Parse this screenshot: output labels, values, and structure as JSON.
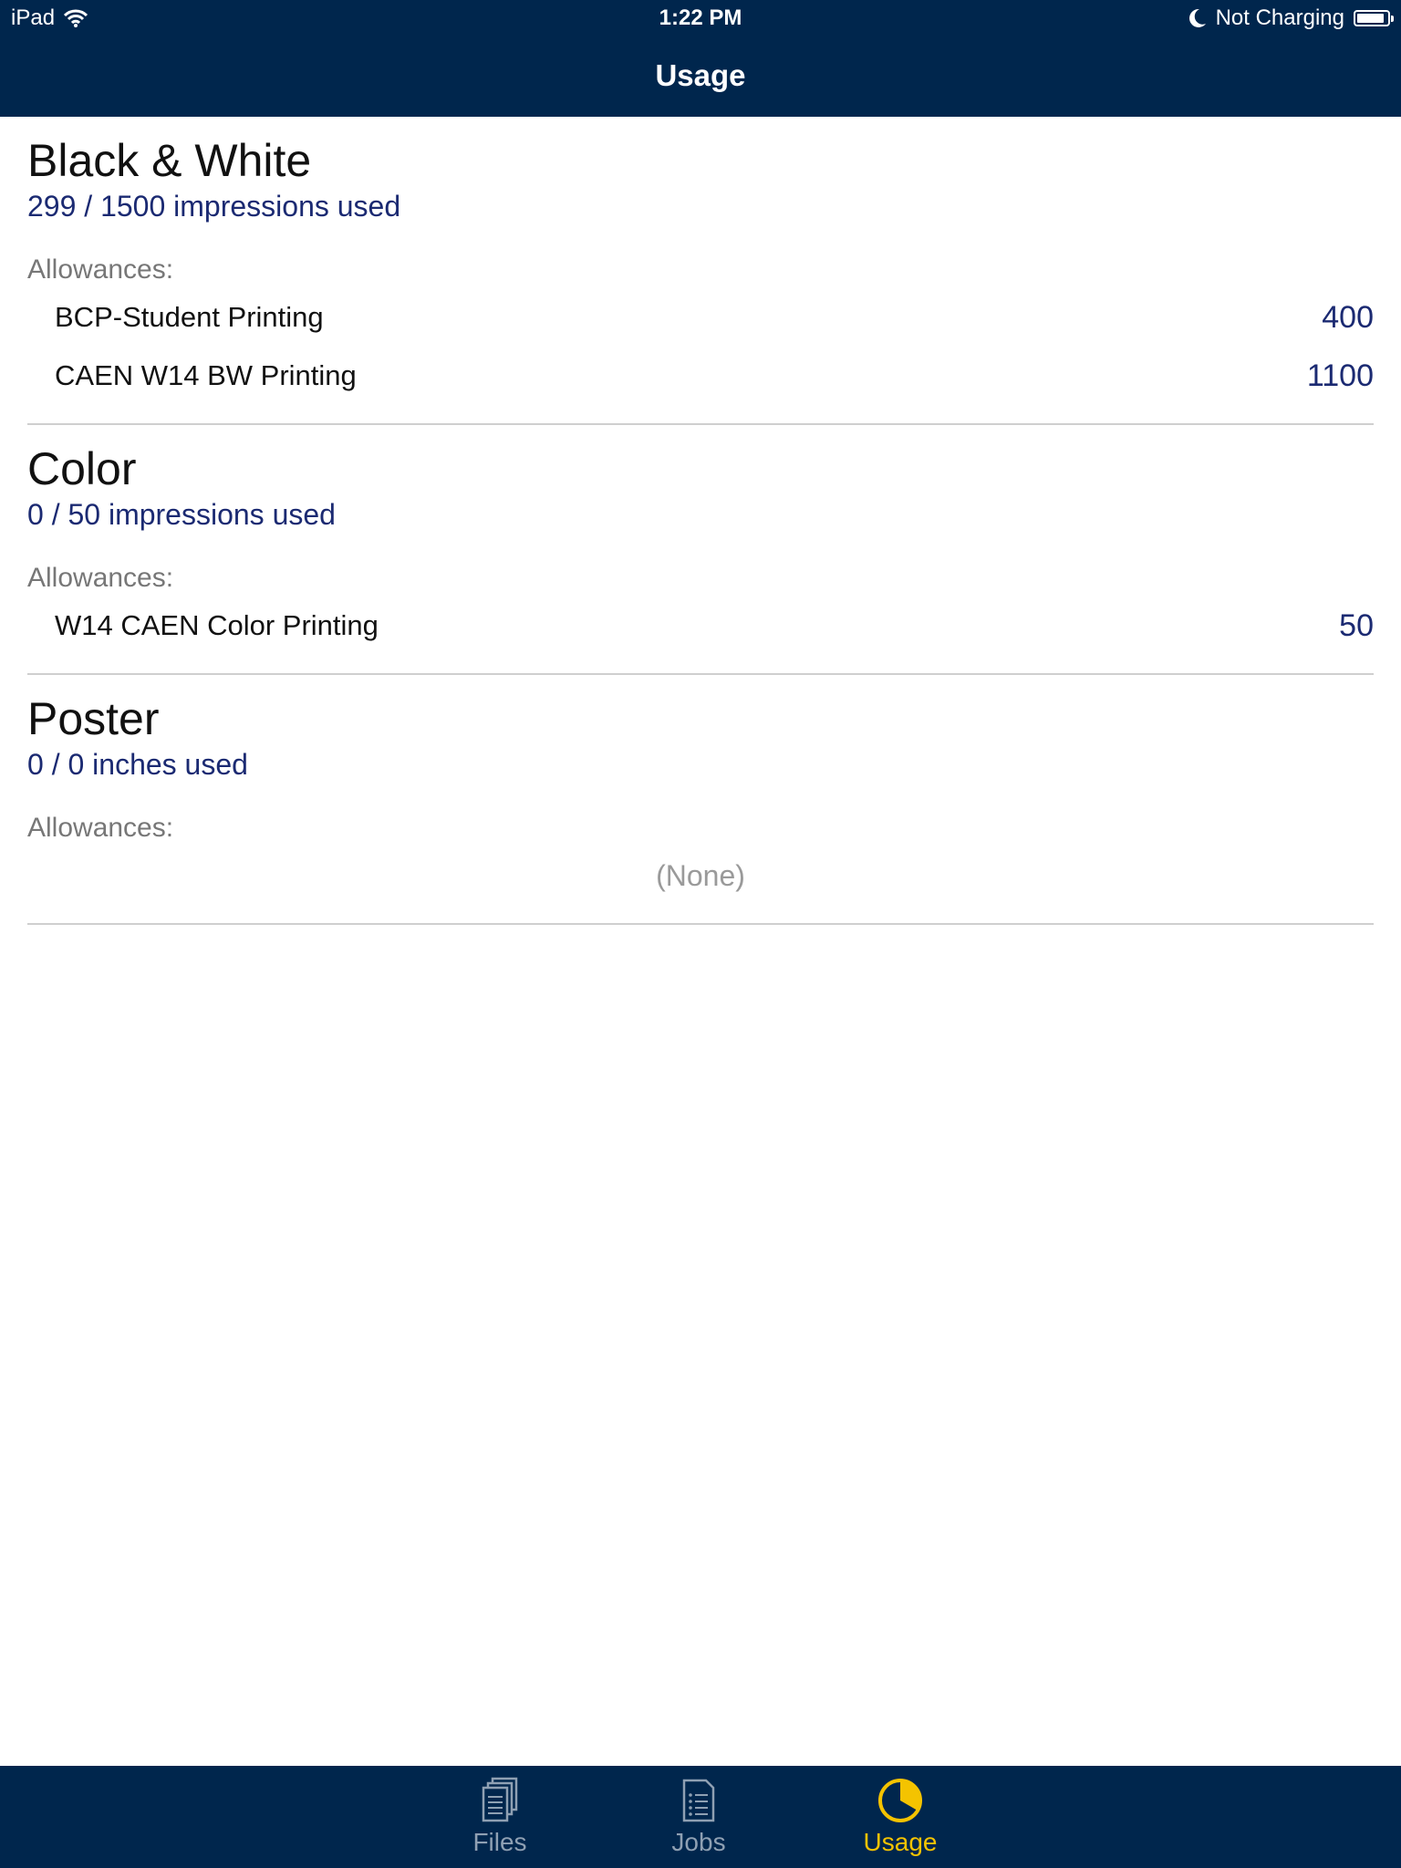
{
  "status": {
    "device": "iPad",
    "time": "1:22 PM",
    "battery_text": "Not Charging",
    "battery_level": 0.9
  },
  "nav": {
    "title": "Usage"
  },
  "sections": [
    {
      "title": "Black & White",
      "usage": "299 / 1500 impressions used",
      "allow_label": "Allowances:",
      "allowances": [
        {
          "name": "BCP-Student Printing",
          "value": "400"
        },
        {
          "name": "CAEN W14 BW Printing",
          "value": "1100"
        }
      ]
    },
    {
      "title": "Color",
      "usage": "0 / 50 impressions used",
      "allow_label": "Allowances:",
      "allowances": [
        {
          "name": "W14 CAEN Color Printing",
          "value": "50"
        }
      ]
    },
    {
      "title": "Poster",
      "usage": "0 / 0 inches used",
      "allow_label": "Allowances:",
      "none_text": "(None)"
    }
  ],
  "tabs": [
    {
      "label": "Files",
      "icon": "files-icon"
    },
    {
      "label": "Jobs",
      "icon": "jobs-icon"
    },
    {
      "label": "Usage",
      "icon": "pie-chart-icon",
      "active": true
    }
  ],
  "colors": {
    "nav_bg": "#00264d",
    "accent": "#f4c300",
    "usage_text": "#1b2a72"
  }
}
